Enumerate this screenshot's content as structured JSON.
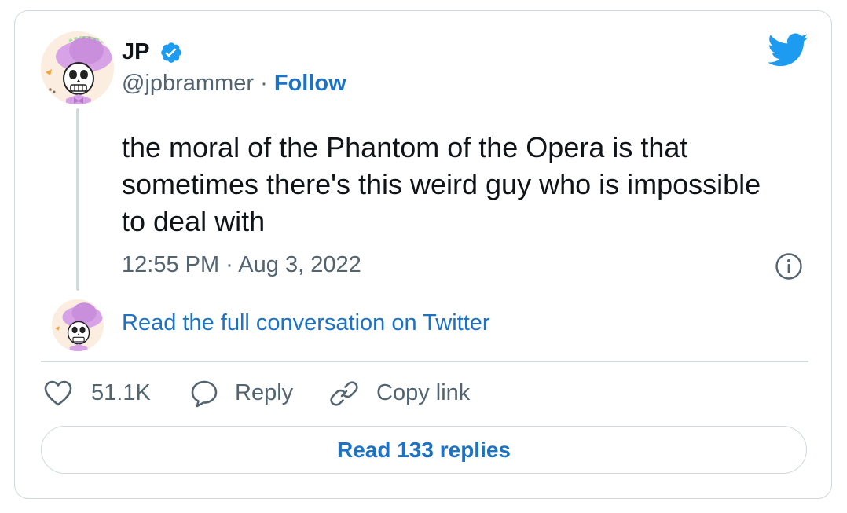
{
  "author": {
    "name": "JP",
    "handle": "@jpbrammer",
    "separator": " · ",
    "follow_label": "Follow",
    "verified": true,
    "avatar_icon": "skeleton-mariachi-avatar"
  },
  "tweet": {
    "text": "the moral of the Phantom of the Opera is that sometimes there's this weird guy who is impossible to deal with",
    "timestamp": "12:55 PM · Aug 3, 2022"
  },
  "conversation": {
    "link_label": "Read the full conversation on Twitter"
  },
  "actions": {
    "like_count": "51.1K",
    "reply_label": "Reply",
    "copy_link_label": "Copy link"
  },
  "footer": {
    "replies_button_label": "Read 133 replies"
  },
  "icons": {
    "brand": "twitter-bird-icon",
    "verified": "verified-badge-icon",
    "info": "info-icon",
    "like": "heart-icon",
    "reply": "speech-bubble-icon",
    "copy": "link-icon"
  },
  "colors": {
    "twitter_blue": "#1d9bf0",
    "link_blue": "#1d72c4",
    "text_primary": "#0f1419",
    "text_secondary": "#536471",
    "border": "#cfd9de"
  }
}
